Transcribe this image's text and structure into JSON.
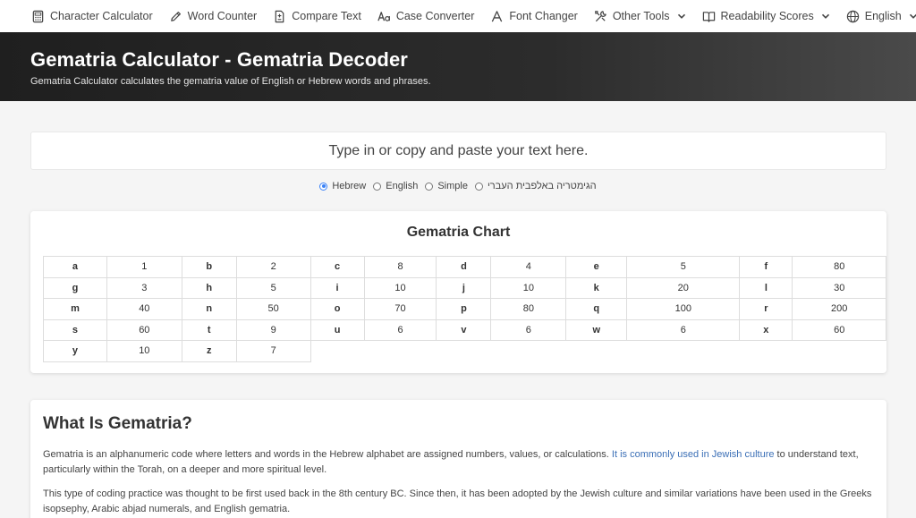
{
  "nav": {
    "items": [
      {
        "label": "Character Calculator",
        "icon": "calculator-icon"
      },
      {
        "label": "Word Counter",
        "icon": "pencil-icon"
      },
      {
        "label": "Compare Text",
        "icon": "compare-doc-icon"
      },
      {
        "label": "Case Converter",
        "icon": "case-icon"
      },
      {
        "label": "Font Changer",
        "icon": "font-a-icon"
      },
      {
        "label": "Other Tools",
        "icon": "tools-icon"
      },
      {
        "label": "Readability Scores",
        "icon": "book-icon"
      },
      {
        "label": "English",
        "icon": "globe-icon"
      }
    ]
  },
  "hero": {
    "title": "Gematria Calculator - Gematria Decoder",
    "subtitle": "Gematria Calculator calculates the gematria value of English or Hebrew words and phrases."
  },
  "input": {
    "placeholder": "Type in or copy and paste your text here."
  },
  "modes": {
    "options": [
      "Hebrew",
      "English",
      "Simple",
      "הגימטריה באלפבית העברי"
    ],
    "selected": "Hebrew"
  },
  "chart": {
    "title": "Gematria Chart",
    "rows": [
      [
        [
          "a",
          "1"
        ],
        [
          "b",
          "2"
        ],
        [
          "c",
          "8"
        ],
        [
          "d",
          "4"
        ],
        [
          "e",
          "5"
        ],
        [
          "f",
          "80"
        ]
      ],
      [
        [
          "g",
          "3"
        ],
        [
          "h",
          "5"
        ],
        [
          "i",
          "10"
        ],
        [
          "j",
          "10"
        ],
        [
          "k",
          "20"
        ],
        [
          "l",
          "30"
        ]
      ],
      [
        [
          "m",
          "40"
        ],
        [
          "n",
          "50"
        ],
        [
          "o",
          "70"
        ],
        [
          "p",
          "80"
        ],
        [
          "q",
          "100"
        ],
        [
          "r",
          "200"
        ]
      ],
      [
        [
          "s",
          "60"
        ],
        [
          "t",
          "9"
        ],
        [
          "u",
          "6"
        ],
        [
          "v",
          "6"
        ],
        [
          "w",
          "6"
        ],
        [
          "x",
          "60"
        ]
      ],
      [
        [
          "y",
          "10"
        ],
        [
          "z",
          "7"
        ]
      ]
    ]
  },
  "article": {
    "heading": "What Is Gematria?",
    "p1_before": "Gematria is an alphanumeric code where letters and words in the Hebrew alphabet are assigned numbers, values, or calculations. ",
    "p1_link": "It is commonly used in Jewish culture",
    "p1_after": " to understand text, particularly within the Torah, on a deeper and more spiritual level.",
    "p2": "This type of coding practice was thought to be first used back in the 8th century BC. Since then, it has been adopted by the Jewish culture and similar variations have been used in the Greeks isopsephy, Arabic abjad numerals, and English gematria."
  },
  "colors": {
    "accent": "#3b82f6",
    "link": "#3b6fb6",
    "hero_bg": "#1f1f1f"
  }
}
